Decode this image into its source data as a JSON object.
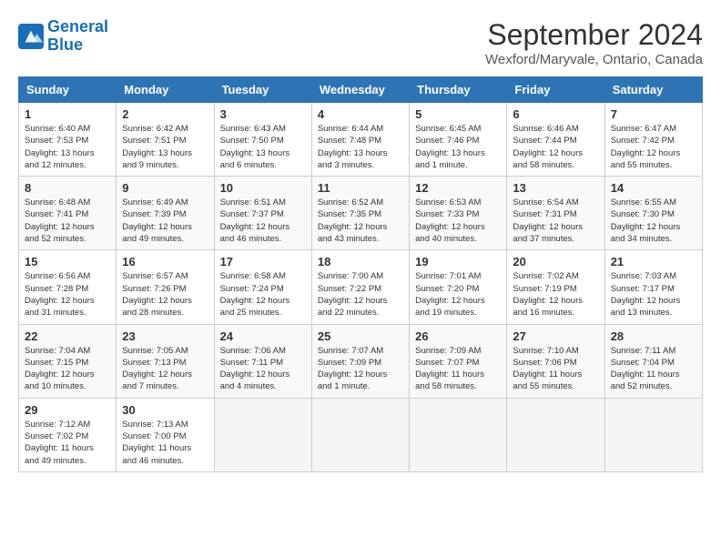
{
  "header": {
    "logo_line1": "General",
    "logo_line2": "Blue",
    "title": "September 2024",
    "subtitle": "Wexford/Maryvale, Ontario, Canada"
  },
  "days_of_week": [
    "Sunday",
    "Monday",
    "Tuesday",
    "Wednesday",
    "Thursday",
    "Friday",
    "Saturday"
  ],
  "weeks": [
    [
      {
        "day": "1",
        "sunrise": "6:40 AM",
        "sunset": "7:53 PM",
        "daylight": "13 hours and 12 minutes."
      },
      {
        "day": "2",
        "sunrise": "6:42 AM",
        "sunset": "7:51 PM",
        "daylight": "13 hours and 9 minutes."
      },
      {
        "day": "3",
        "sunrise": "6:43 AM",
        "sunset": "7:50 PM",
        "daylight": "13 hours and 6 minutes."
      },
      {
        "day": "4",
        "sunrise": "6:44 AM",
        "sunset": "7:48 PM",
        "daylight": "13 hours and 3 minutes."
      },
      {
        "day": "5",
        "sunrise": "6:45 AM",
        "sunset": "7:46 PM",
        "daylight": "13 hours and 1 minute."
      },
      {
        "day": "6",
        "sunrise": "6:46 AM",
        "sunset": "7:44 PM",
        "daylight": "12 hours and 58 minutes."
      },
      {
        "day": "7",
        "sunrise": "6:47 AM",
        "sunset": "7:42 PM",
        "daylight": "12 hours and 55 minutes."
      }
    ],
    [
      {
        "day": "8",
        "sunrise": "6:48 AM",
        "sunset": "7:41 PM",
        "daylight": "12 hours and 52 minutes."
      },
      {
        "day": "9",
        "sunrise": "6:49 AM",
        "sunset": "7:39 PM",
        "daylight": "12 hours and 49 minutes."
      },
      {
        "day": "10",
        "sunrise": "6:51 AM",
        "sunset": "7:37 PM",
        "daylight": "12 hours and 46 minutes."
      },
      {
        "day": "11",
        "sunrise": "6:52 AM",
        "sunset": "7:35 PM",
        "daylight": "12 hours and 43 minutes."
      },
      {
        "day": "12",
        "sunrise": "6:53 AM",
        "sunset": "7:33 PM",
        "daylight": "12 hours and 40 minutes."
      },
      {
        "day": "13",
        "sunrise": "6:54 AM",
        "sunset": "7:31 PM",
        "daylight": "12 hours and 37 minutes."
      },
      {
        "day": "14",
        "sunrise": "6:55 AM",
        "sunset": "7:30 PM",
        "daylight": "12 hours and 34 minutes."
      }
    ],
    [
      {
        "day": "15",
        "sunrise": "6:56 AM",
        "sunset": "7:28 PM",
        "daylight": "12 hours and 31 minutes."
      },
      {
        "day": "16",
        "sunrise": "6:57 AM",
        "sunset": "7:26 PM",
        "daylight": "12 hours and 28 minutes."
      },
      {
        "day": "17",
        "sunrise": "6:58 AM",
        "sunset": "7:24 PM",
        "daylight": "12 hours and 25 minutes."
      },
      {
        "day": "18",
        "sunrise": "7:00 AM",
        "sunset": "7:22 PM",
        "daylight": "12 hours and 22 minutes."
      },
      {
        "day": "19",
        "sunrise": "7:01 AM",
        "sunset": "7:20 PM",
        "daylight": "12 hours and 19 minutes."
      },
      {
        "day": "20",
        "sunrise": "7:02 AM",
        "sunset": "7:19 PM",
        "daylight": "12 hours and 16 minutes."
      },
      {
        "day": "21",
        "sunrise": "7:03 AM",
        "sunset": "7:17 PM",
        "daylight": "12 hours and 13 minutes."
      }
    ],
    [
      {
        "day": "22",
        "sunrise": "7:04 AM",
        "sunset": "7:15 PM",
        "daylight": "12 hours and 10 minutes."
      },
      {
        "day": "23",
        "sunrise": "7:05 AM",
        "sunset": "7:13 PM",
        "daylight": "12 hours and 7 minutes."
      },
      {
        "day": "24",
        "sunrise": "7:06 AM",
        "sunset": "7:11 PM",
        "daylight": "12 hours and 4 minutes."
      },
      {
        "day": "25",
        "sunrise": "7:07 AM",
        "sunset": "7:09 PM",
        "daylight": "12 hours and 1 minute."
      },
      {
        "day": "26",
        "sunrise": "7:09 AM",
        "sunset": "7:07 PM",
        "daylight": "11 hours and 58 minutes."
      },
      {
        "day": "27",
        "sunrise": "7:10 AM",
        "sunset": "7:06 PM",
        "daylight": "11 hours and 55 minutes."
      },
      {
        "day": "28",
        "sunrise": "7:11 AM",
        "sunset": "7:04 PM",
        "daylight": "11 hours and 52 minutes."
      }
    ],
    [
      {
        "day": "29",
        "sunrise": "7:12 AM",
        "sunset": "7:02 PM",
        "daylight": "11 hours and 49 minutes."
      },
      {
        "day": "30",
        "sunrise": "7:13 AM",
        "sunset": "7:00 PM",
        "daylight": "11 hours and 46 minutes."
      },
      null,
      null,
      null,
      null,
      null
    ]
  ]
}
